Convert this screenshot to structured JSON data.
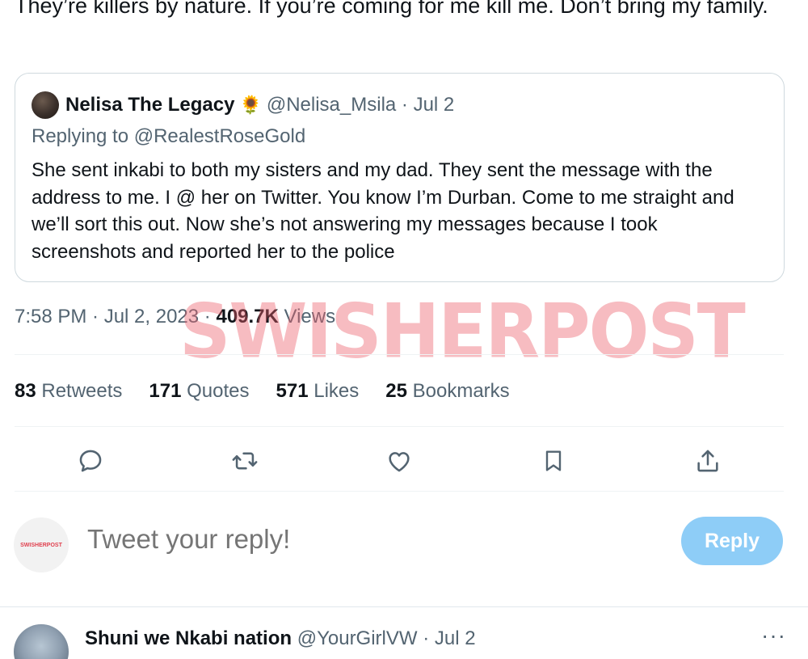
{
  "tweet": {
    "text": "They’re killers by nature. If you’re coming for me kill me. Don’t bring my family."
  },
  "quoted_tweet": {
    "author_name": "Nelisa The Legacy",
    "author_emoji": "🌻",
    "handle_date": "@Nelisa_Msila · Jul 2",
    "replying_to": "Replying to @RealestRoseGold",
    "text": "She sent inkabi to both my sisters and my dad. They sent the message with the address to me. I @ her on Twitter. You know I’m Durban. Come to me straight and we’ll sort this out. Now she’s not answering my messages because I took screenshots and reported her to the police"
  },
  "meta": {
    "timestamp": "7:58 PM · Jul 2, 2023 · ",
    "views_count": "409.7K",
    "views_label": " Views"
  },
  "watermark": "SWISHERPOST",
  "stats": [
    {
      "count": "83",
      "label": " Retweets"
    },
    {
      "count": "171",
      "label": " Quotes"
    },
    {
      "count": "571",
      "label": " Likes"
    },
    {
      "count": "25",
      "label": " Bookmarks"
    }
  ],
  "actions": {
    "icons": [
      "reply-icon",
      "retweet-icon",
      "like-icon",
      "bookmark-icon",
      "share-icon"
    ]
  },
  "reply_box": {
    "avatar_text": "SWISHERPOST",
    "placeholder": "Tweet your reply!",
    "button_label": "Reply"
  },
  "next_tweet": {
    "author_name": "Shuni we Nkabi nation",
    "handle_date": "@YourGirlVW · Jul 2",
    "more": "···"
  },
  "colors": {
    "text_primary": "#0f1419",
    "text_secondary": "#536471",
    "border": "#cfd9de",
    "reply_button": "#8ecdf7",
    "watermark": "#ec606c"
  }
}
